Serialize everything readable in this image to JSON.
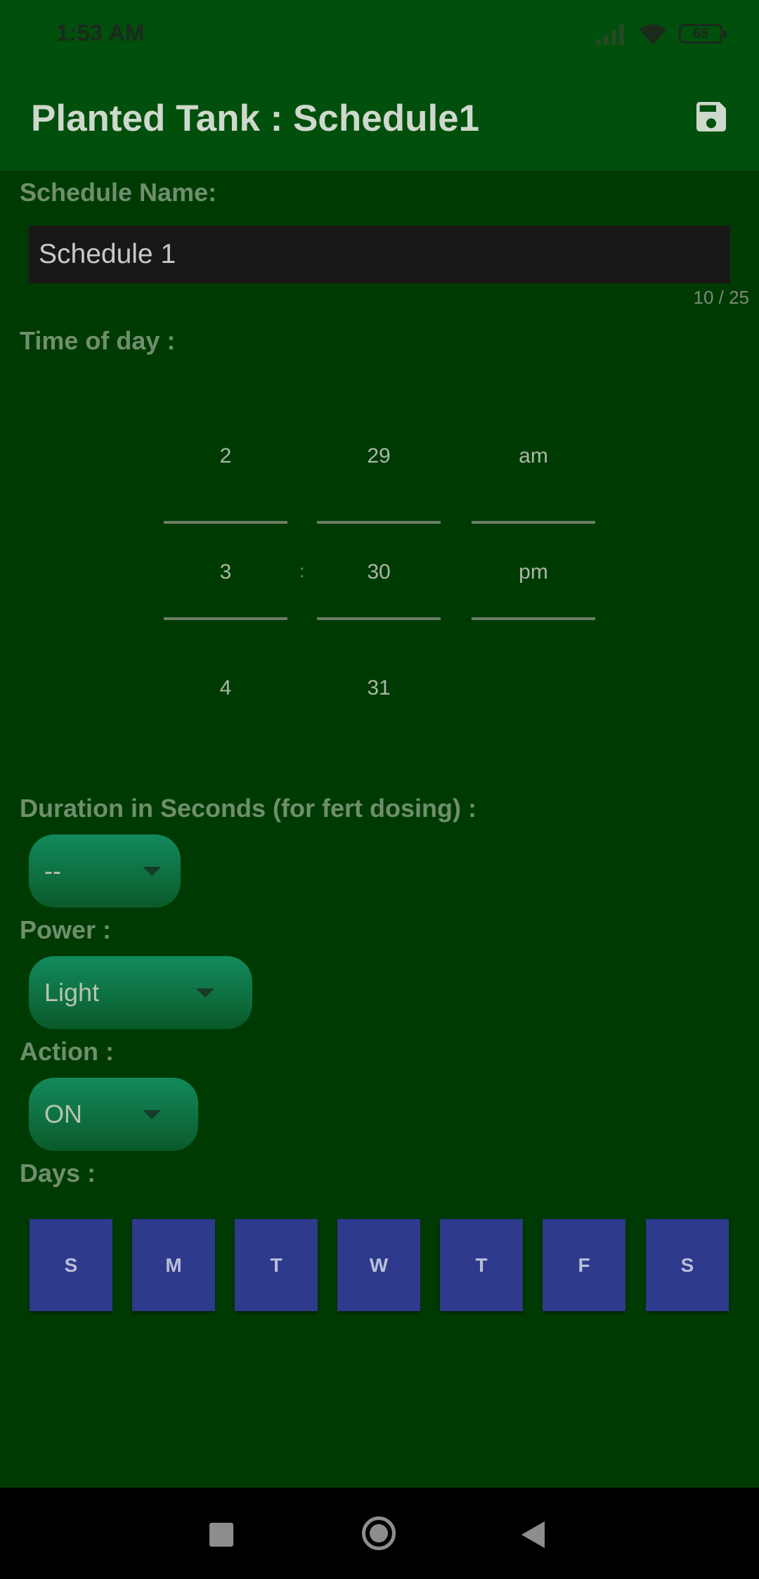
{
  "status_bar": {
    "time": "1:53 AM",
    "battery_level": "65",
    "icons": [
      "signal-icon",
      "wifi-icon",
      "battery-icon"
    ]
  },
  "app_bar": {
    "title": "Planted Tank : Schedule1",
    "save_icon": "save-icon"
  },
  "schedule_name": {
    "label": "Schedule Name:",
    "value": "Schedule 1",
    "counter": "10 / 25"
  },
  "time_of_day": {
    "label": "Time of day :",
    "separator": ":",
    "hour": {
      "above": "2",
      "selected": "3",
      "below": "4"
    },
    "minute": {
      "above": "29",
      "selected": "30",
      "below": "31"
    },
    "ampm": {
      "above": "am",
      "selected": "pm"
    }
  },
  "duration": {
    "label": "Duration in Seconds (for fert dosing) :",
    "value": "--"
  },
  "power": {
    "label": "Power :",
    "value": "Light"
  },
  "action": {
    "label": "Action :",
    "value": "ON"
  },
  "days": {
    "label": "Days :",
    "items": [
      "S",
      "M",
      "T",
      "W",
      "T",
      "F",
      "S"
    ]
  },
  "colors": {
    "background": "#003a03",
    "app_bar": "#014f0c",
    "day_button": "#2e3a8c",
    "spinner": "#138a5c"
  }
}
